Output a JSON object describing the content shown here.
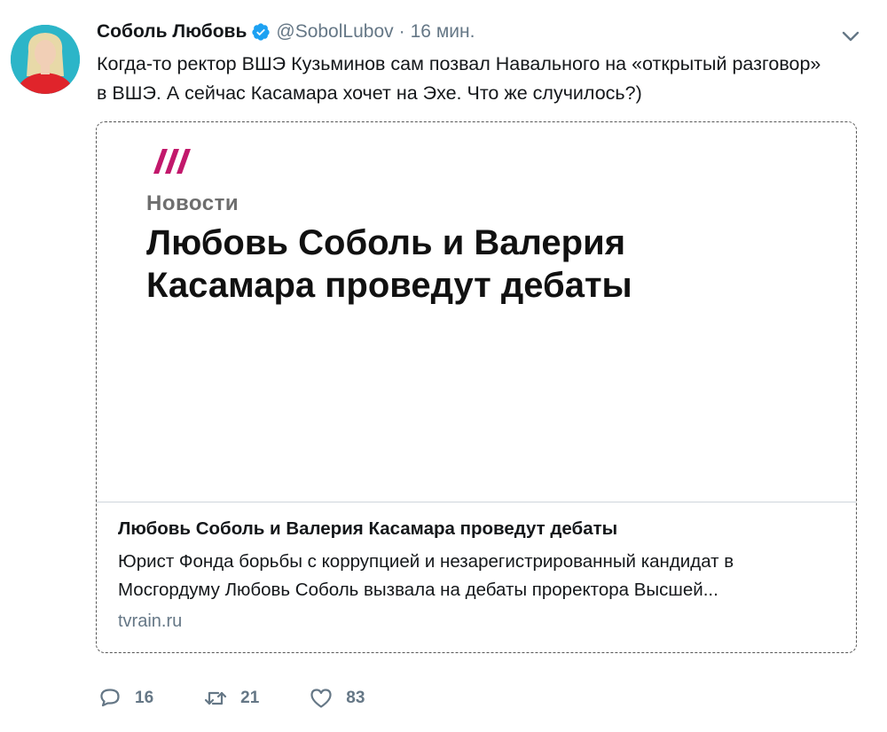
{
  "author": {
    "display_name": "Соболь Любовь",
    "handle": "@SobolLubov",
    "separator": "·",
    "time": "16 мин.",
    "verified": true
  },
  "icons": {
    "verified": "verified-badge-icon",
    "caret": "chevron-down-icon",
    "reply": "reply-icon",
    "retweet": "retweet-icon",
    "like": "heart-icon",
    "logo": "tvrain-logo-icon"
  },
  "tweet": {
    "text": "Когда-то ректор ВШЭ Кузьминов сам позвал Навального на «открытый разговор» в ВШЭ. А сейчас Касамара хочет на Эхе. Что же случилось?)"
  },
  "card": {
    "image_kicker": "Новости",
    "image_headline": "Любовь Соболь и Валерия Касамара проведут дебаты",
    "title": "Любовь Соболь и Валерия Касамара проведут дебаты",
    "description": "Юрист Фонда борьбы с коррупцией и незарегистрированный кандидат в Мосгордуму Любовь Соболь вызвала на дебаты проректора Высшей...",
    "domain": "tvrain.ru"
  },
  "actions": {
    "replies": "16",
    "retweets": "21",
    "likes": "83"
  },
  "colors": {
    "verified": "#1da1f2",
    "secondary_text": "#657786",
    "logo": "#c2186b",
    "avatar_bg": "#2cb5c8",
    "avatar_shirt": "#e0242b"
  }
}
